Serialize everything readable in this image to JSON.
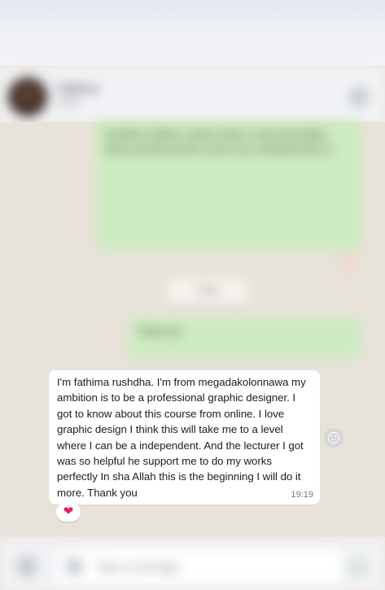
{
  "header": {
    "contact_name": "Fathima",
    "contact_status": "online"
  },
  "date_chip": "Today",
  "outgoing": [
    "Assalamu alaikum, please share a short description about yourself and the course you completed with us.",
    "Thank you"
  ],
  "message": {
    "text": "I'm fathima rushdha. I'm from megadakolonnawa my ambition is to be a professional graphic designer. I got to know about this course from online. I love graphic design I think this will take me to a level where I can be a independent. And the lecturer I got was so helpful he support me to do my works perfectly In sha Allah this is the beginning I will do it more. Thank you",
    "time": "19:19",
    "reaction": "❤"
  },
  "composer": {
    "placeholder": "Type a message"
  },
  "icons": {
    "reaction_button": "emoji-face-icon",
    "emoji": "emoji-icon",
    "attach": "attach-icon",
    "mic": "mic-icon",
    "menu": "menu-icon"
  },
  "colors": {
    "outgoing_bubble": "#cdebc0",
    "incoming_bubble": "#ffffff",
    "chat_background": "#efeae2",
    "heart": "#e0245e"
  }
}
